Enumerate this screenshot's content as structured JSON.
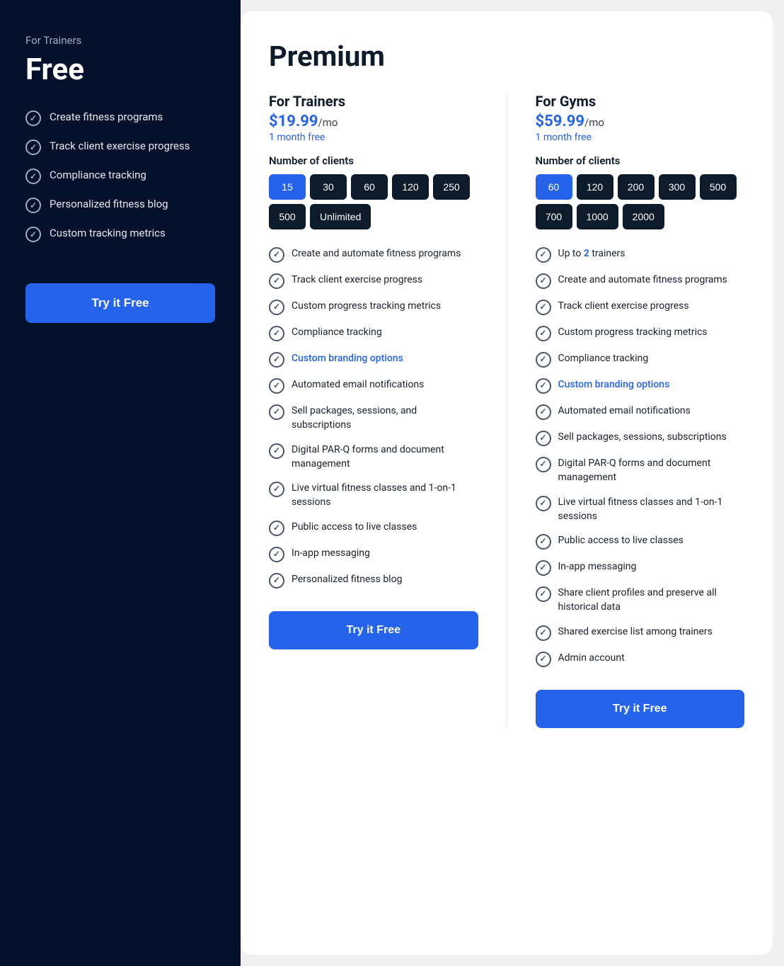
{
  "left": {
    "for_label": "For Trainers",
    "plan_name": "Free",
    "features": [
      "Create fitness programs",
      "Track client exercise progress",
      "Compliance tracking",
      "Personalized fitness blog",
      "Custom tracking metrics"
    ],
    "cta": "Try it Free"
  },
  "right": {
    "title": "Premium",
    "trainers": {
      "for_label": "For Trainers",
      "price": "$19.99",
      "per_mo": "/mo",
      "free_month": "1 month free",
      "clients_label": "Number of clients",
      "client_options": [
        "15",
        "30",
        "60",
        "120",
        "250",
        "500",
        "Unlimited"
      ],
      "active_client": "15",
      "features": [
        "Create and automate fitness programs",
        "Track client exercise progress",
        "Custom progress tracking metrics",
        "Compliance tracking",
        "Custom branding options",
        "Automated email notifications",
        "Sell packages, sessions, and subscriptions",
        "Digital PAR-Q forms and document management",
        "Live virtual fitness classes and 1-on-1 sessions",
        "Public access to live classes",
        "In-app messaging",
        "Personalized fitness blog"
      ],
      "highlight_features": [
        "Custom branding options"
      ],
      "cta": "Try it Free"
    },
    "gyms": {
      "for_label": "For Gyms",
      "price": "$59.99",
      "per_mo": "/mo",
      "free_month": "1 month free",
      "clients_label": "Number of clients",
      "client_options": [
        "60",
        "120",
        "200",
        "300",
        "500",
        "700",
        "1000",
        "2000"
      ],
      "active_client": "60",
      "features": [
        "Up to {2} trainers",
        "Create and automate fitness programs",
        "Track client exercise progress",
        "Custom progress tracking metrics",
        "Compliance tracking",
        "Custom branding options",
        "Automated email notifications",
        "Sell packages, sessions, subscriptions",
        "Digital PAR-Q forms and document management",
        "Live virtual fitness classes and 1-on-1 sessions",
        "Public access to live classes",
        "In-app messaging",
        "Share client profiles and preserve all historical data",
        "Shared exercise list among trainers",
        "Admin account"
      ],
      "highlight_features": [
        "Custom branding options"
      ],
      "highlight_numbers": [
        "2"
      ],
      "cta": "Try it Free"
    }
  }
}
